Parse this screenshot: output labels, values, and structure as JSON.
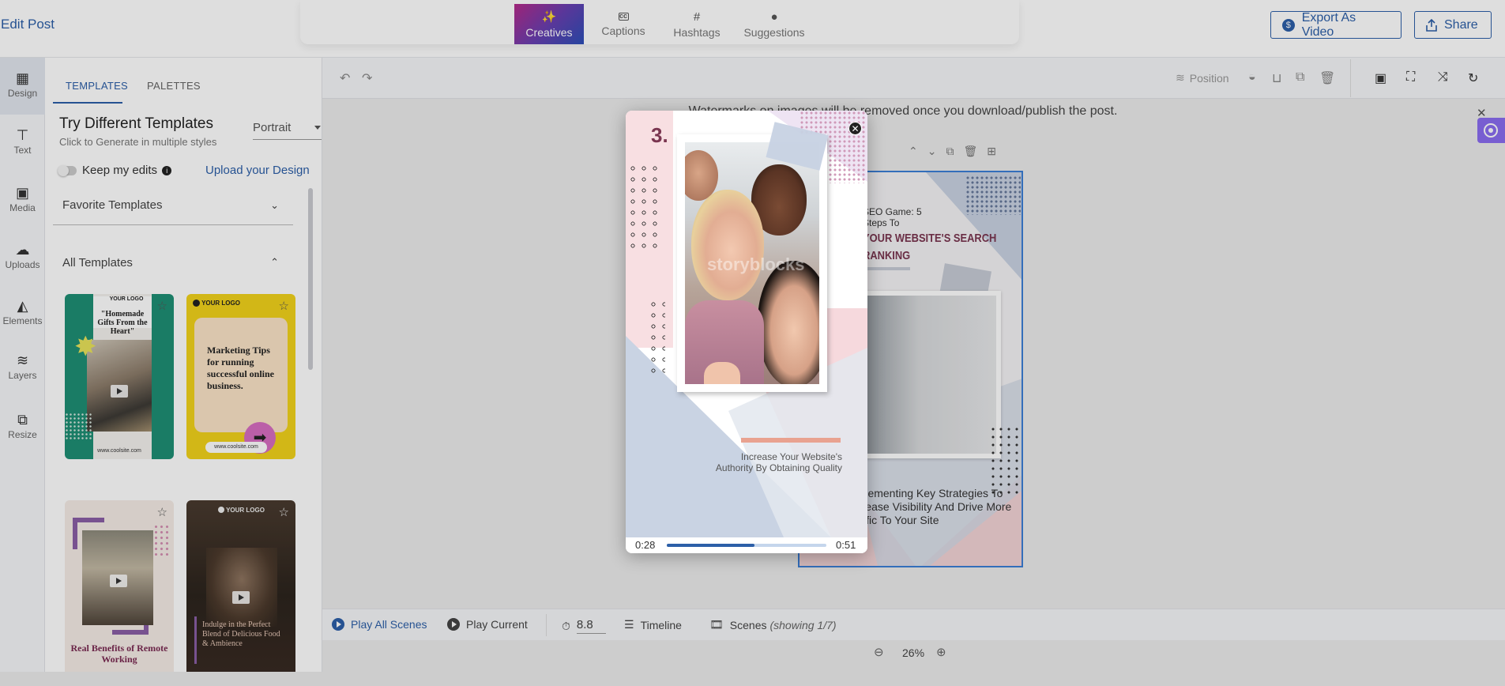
{
  "header": {
    "title": "Edit Post",
    "modes": [
      {
        "label": "Creatives",
        "icon": "magic-wand-icon",
        "active": true
      },
      {
        "label": "Captions",
        "icon": "cc-icon"
      },
      {
        "label": "Hashtags",
        "icon": "hash-icon"
      },
      {
        "label": "Suggestions",
        "icon": "lightbulb-icon"
      }
    ],
    "export_label": "Export As Video",
    "share_label": "Share"
  },
  "rail": [
    {
      "label": "Design",
      "icon": "grid-icon",
      "active": true
    },
    {
      "label": "Text",
      "icon": "text-icon"
    },
    {
      "label": "Media",
      "icon": "image-icon"
    },
    {
      "label": "Uploads",
      "icon": "cloud-upload-icon"
    },
    {
      "label": "Elements",
      "icon": "shapes-icon"
    },
    {
      "label": "Layers",
      "icon": "layers-icon"
    },
    {
      "label": "Resize",
      "icon": "resize-icon"
    }
  ],
  "panel": {
    "tabs": [
      "TEMPLATES",
      "PALETTES"
    ],
    "title": "Try Different Templates",
    "subtitle": "Click to Generate in multiple styles",
    "orientation": "Portrait",
    "keep_edits_label": "Keep my edits",
    "upload_link": "Upload your Design",
    "favorite_templates": "Favorite Templates",
    "all_templates": "All Templates",
    "templates": [
      {
        "logo": "YOUR LOGO",
        "headline": "\"Homemade Gifts From the Heart\"",
        "footer": "www.coolsite.com"
      },
      {
        "logo": "YOUR LOGO",
        "headline": "Marketing Tips for running successful online business.",
        "footer": "www.coolsite.com"
      },
      {
        "logo": "",
        "headline": "Real Benefits of Remote Working",
        "footer": ""
      },
      {
        "logo": "YOUR LOGO",
        "headline": "Indulge in the Perfect Blend of Delicious Food & Ambience",
        "footer": ""
      }
    ]
  },
  "toolbar": {
    "position_label": "Position"
  },
  "workspace": {
    "notice": "Watermarks on images will be removed once you download/publish the post.",
    "canvas": {
      "line1": "SEO Game: 5",
      "line2": "Steps To",
      "line3": "YOUR WEBSITE'S SEARCH",
      "line4": "RANKING",
      "body": "Implementing Key Strategies To Increase Visibility And Drive More Traffic To Your Site"
    }
  },
  "bottombar": {
    "play_all": "Play All Scenes",
    "play_current": "Play Current",
    "duration": "8.8",
    "timeline": "Timeline",
    "scenes_label": "Scenes",
    "scenes_count": "(showing 1/7)",
    "zoom": "26%"
  },
  "modal": {
    "step_number": "3.",
    "caption_line1": "Increase Your Website's",
    "caption_line2": "Authority By Obtaining Quality",
    "watermark": "storyblocks",
    "time_current": "0:28",
    "time_total": "0:51",
    "progress": 0.55
  },
  "colors": {
    "accent": "#2c5fa8",
    "template_green": "#1e8f75",
    "template_yellow": "#f2d31b",
    "modal_pink": "#f6d9dd",
    "modal_blue": "#c9d3e3"
  }
}
